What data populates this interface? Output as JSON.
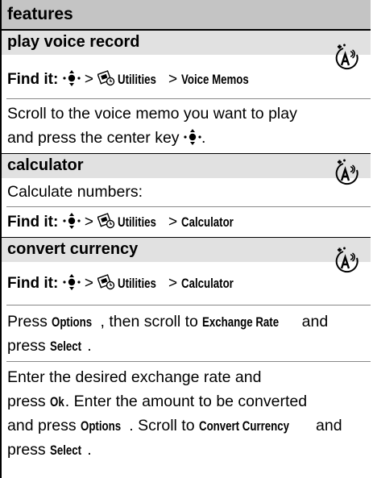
{
  "header": {
    "title": "features"
  },
  "find_prefix": "Find it:",
  "separator": ">",
  "sections": [
    {
      "title": "play voice record",
      "find_path": [
        "Utilities",
        "Voice Memos"
      ],
      "body": [
        "Scroll to the voice memo you want to play",
        "and press the center key"
      ]
    },
    {
      "title": "calculator",
      "intro": "Calculate numbers:",
      "find_path": [
        "Utilities",
        "Calculator"
      ]
    },
    {
      "title": "convert currency",
      "find_path": [
        "Utilities",
        "Calculator"
      ],
      "step1": {
        "a": "Press",
        "k1": "Options",
        "b": ", then scroll to",
        "k2": "Exchange Rate",
        "c": "and",
        "d": "press",
        "k3": "Select",
        "e": "."
      },
      "step2": {
        "line1": "Enter the desired exchange rate and",
        "a": "press",
        "k1": "Ok",
        "b": ". Enter the amount to be converted",
        "c": "and press",
        "k2": "Options",
        "d": ". Scroll to",
        "k3": "Convert Currency",
        "e": "and",
        "f": "press",
        "k4": "Select",
        "g": "."
      }
    }
  ],
  "icons": {
    "nav": "center-key-icon",
    "menu": "utilities-menu-icon",
    "feature": "network-feature-icon"
  }
}
